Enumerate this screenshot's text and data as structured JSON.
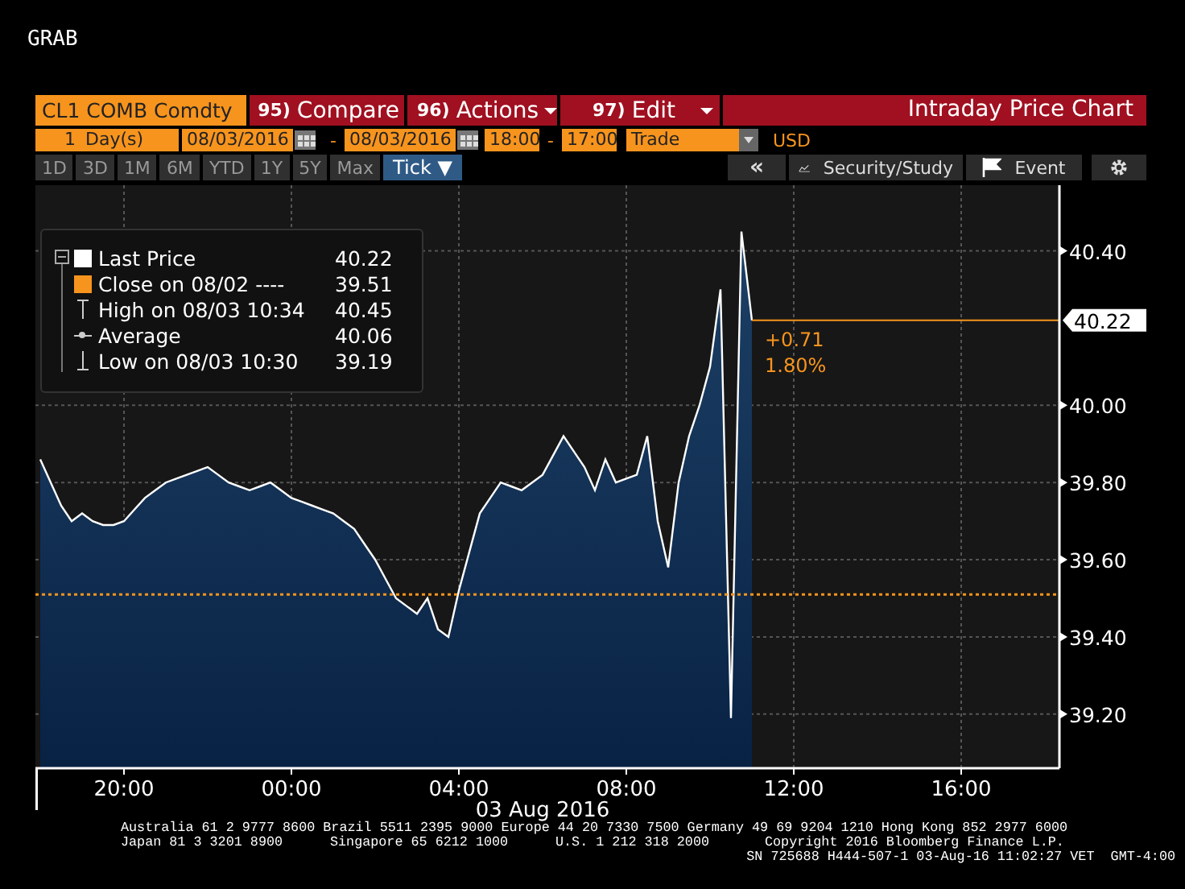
{
  "window": {
    "title": "GRAB"
  },
  "toolbar": {
    "security": "CL1 COMB Comdty",
    "buttons": [
      {
        "number": "95)",
        "label": "Compare",
        "dropdown": false
      },
      {
        "number": "96)",
        "label": "Actions",
        "dropdown": true
      },
      {
        "number": "97)",
        "label": "Edit",
        "dropdown": true
      }
    ],
    "title": "Intraday Price Chart"
  },
  "range_controls": [
    {
      "kind": "count",
      "text": "1"
    },
    {
      "kind": "unit",
      "text": "Day(s)"
    },
    {
      "kind": "date",
      "text": "08/03/2016"
    },
    {
      "kind": "calendar"
    },
    {
      "kind": "separator",
      "text": "-"
    },
    {
      "kind": "date",
      "text": "08/03/2016"
    },
    {
      "kind": "calendar"
    },
    {
      "kind": "time",
      "text": "18:00"
    },
    {
      "kind": "separator",
      "text": "-"
    },
    {
      "kind": "time",
      "text": "17:00"
    },
    {
      "kind": "dropdown",
      "text": "Trade"
    },
    {
      "kind": "currency",
      "text": "USD"
    }
  ],
  "periods": [
    {
      "label": "1D",
      "selected": false
    },
    {
      "label": "3D",
      "selected": false
    },
    {
      "label": "1M",
      "selected": false
    },
    {
      "label": "6M",
      "selected": false
    },
    {
      "label": "YTD",
      "selected": false
    },
    {
      "label": "1Y",
      "selected": false
    },
    {
      "label": "5Y",
      "selected": false
    },
    {
      "label": "Max",
      "selected": false
    },
    {
      "label": "Tick ▼",
      "selected": true
    }
  ],
  "tools": [
    {
      "kind": "back",
      "text": "«"
    },
    {
      "kind": "study",
      "text": "Security/Study"
    },
    {
      "kind": "event",
      "text": "Event"
    },
    {
      "kind": "settings"
    }
  ],
  "legend": {
    "expanded": true,
    "items": [
      {
        "kind": "swatch",
        "color": "#ffffff",
        "value": "40.22"
      },
      {
        "kind": "swatch",
        "color": "#f7941d",
        "label": "Close on 08/02 ----",
        "value": "39.51"
      },
      {
        "kind": "high",
        "label": "High on 08/03 10:34",
        "value": "40.45"
      },
      {
        "kind": "average",
        "label": "Average",
        "value": "40.06"
      },
      {
        "kind": "low",
        "label": "Low on 08/03 10:30",
        "value": "39.19"
      }
    ]
  },
  "chart": {
    "date_label": "03 Aug 2016",
    "chart_data": {
      "type": "area",
      "categories": [
        null,
        null,
        null,
        null,
        null,
        null,
        null,
        null,
        "20:00",
        null,
        null,
        null,
        null,
        null,
        null,
        null,
        null,
        null,
        null,
        null,
        null,
        null,
        null,
        null,
        "00:00",
        null,
        null,
        null,
        null,
        null,
        null,
        null,
        null,
        null,
        null,
        null,
        null,
        null,
        null,
        null,
        "04:00",
        null,
        null,
        null,
        null,
        null,
        null,
        null,
        null,
        null,
        null,
        null,
        null,
        null,
        null,
        null,
        "08:00",
        null,
        null,
        null,
        null,
        null,
        null,
        null,
        null,
        null,
        null,
        null,
        null,
        null,
        null,
        null,
        "12:00",
        null,
        null,
        null,
        null,
        null,
        null,
        null,
        null,
        null,
        null,
        null,
        null,
        null,
        null,
        null,
        "16:00",
        null,
        null,
        null,
        null,
        null,
        null,
        null
      ],
      "series": [
        {
          "name": "Last Price",
          "color": "#ffffff",
          "values": [
            39.86,
            39.8,
            39.74,
            39.7,
            39.72,
            39.7,
            39.69,
            39.69,
            39.7,
            39.73,
            39.76,
            39.78,
            39.8,
            39.81,
            39.82,
            39.83,
            39.84,
            39.82,
            39.8,
            39.79,
            39.78,
            39.79,
            39.8,
            39.78,
            39.76,
            39.75,
            39.74,
            39.73,
            39.72,
            39.7,
            39.68,
            39.64,
            39.6,
            39.55,
            39.5,
            39.48,
            39.46,
            39.5,
            39.42,
            39.4,
            39.52,
            39.62,
            39.72,
            39.76,
            39.8,
            39.79,
            39.78,
            39.8,
            39.82,
            39.87,
            39.92,
            39.88,
            39.84,
            39.78,
            39.86,
            39.8,
            39.81,
            39.82,
            39.92,
            39.7,
            39.58,
            39.8,
            39.92,
            40.0,
            40.1,
            40.3,
            39.19,
            40.45,
            40.22,
            null,
            null,
            null,
            null,
            null,
            null,
            null,
            null,
            null,
            null,
            null,
            null,
            null,
            null,
            null,
            null,
            null,
            null,
            null,
            null,
            null,
            null,
            null,
            null,
            null,
            null,
            null
          ]
        }
      ],
      "ylim": [
        39.06,
        40.57
      ],
      "yticks": [
        {
          "value": 39.2,
          "label": "39.20"
        },
        {
          "value": 39.4,
          "label": "39.40"
        },
        {
          "value": 39.6,
          "label": "39.60"
        },
        {
          "value": 39.8,
          "label": "39.80"
        },
        {
          "value": 40.0,
          "label": "40.00"
        },
        {
          "value": 40.4,
          "label": "40.40"
        }
      ],
      "grid": true,
      "ref_lines": [
        {
          "axis": "y",
          "value": 39.51,
          "color": "#f7941d"
        },
        {
          "axis": "y",
          "value": 40.22,
          "label": "40.22",
          "color": "#f7941d"
        }
      ],
      "annotations": [
        {
          "text": "+0.71"
        },
        {
          "text": "1.80%"
        }
      ]
    }
  },
  "footer": [
    [
      "Australia 61 2 9777 8600 Brazil 5511 2395 9000 Europe 44 20 7330 7500 Germany 49 69 9204 1210 Hong Kong 852 2977 6000"
    ],
    [
      "Japan 81 3 3201 8900",
      "Singapore 65 6212 1000",
      "U.S. 1 212 318 2000",
      "Copyright 2016 Bloomberg Finance L.P."
    ],
    [
      "SN 725688 H444-507-1 03-Aug-16 11:02:27 VET  GMT-4:00"
    ]
  ]
}
